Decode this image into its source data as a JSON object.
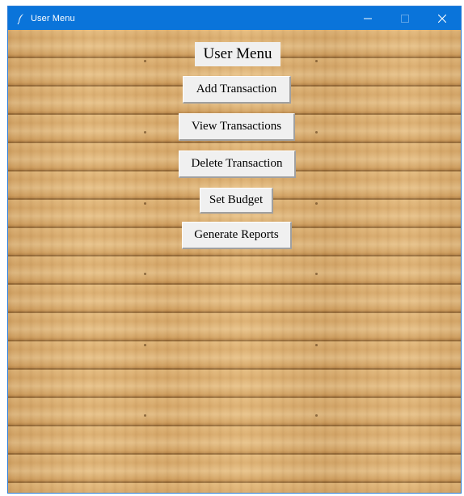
{
  "window": {
    "title": "User Menu",
    "app_icon": "feather-icon",
    "controls": {
      "minimize": "—",
      "maximize": "☐",
      "close": "✕"
    },
    "accent": "#0a74da"
  },
  "menu": {
    "heading": "User Menu",
    "buttons": [
      {
        "label": "Add Transaction"
      },
      {
        "label": "View Transactions"
      },
      {
        "label": "Delete Transaction"
      },
      {
        "label": "Set Budget"
      },
      {
        "label": "Generate Reports"
      }
    ]
  },
  "background": {
    "texture": "wood-planks",
    "base_color": "#d9ad70"
  }
}
